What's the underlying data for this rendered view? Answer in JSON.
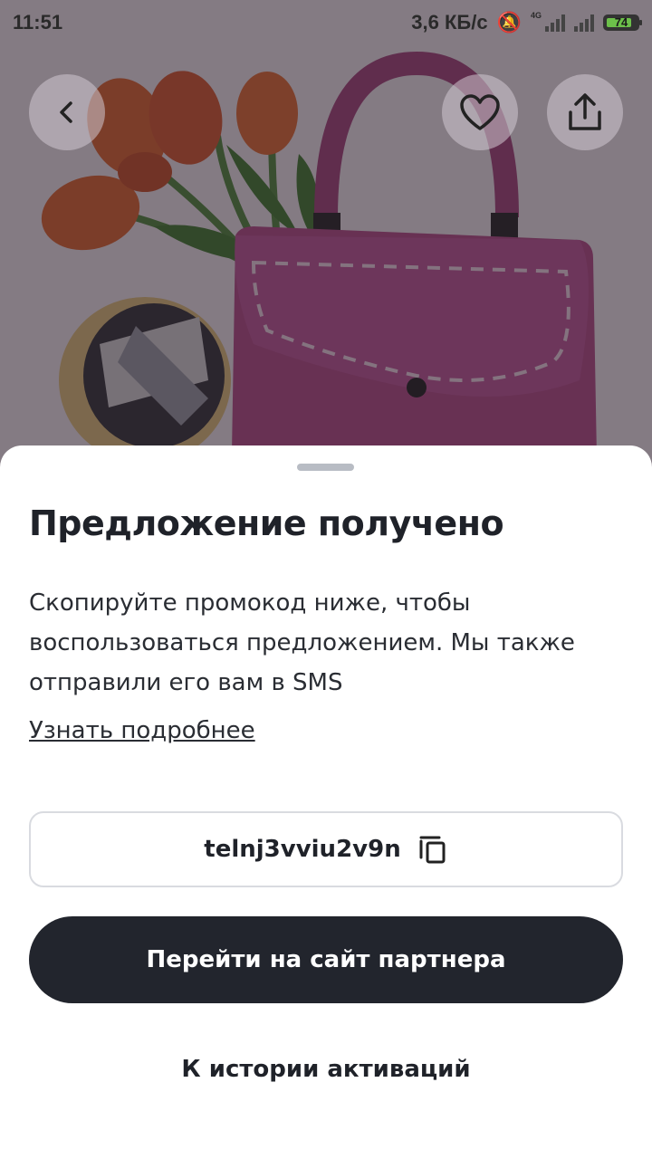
{
  "status_bar": {
    "time": "11:51",
    "speed": "3,6 КБ/с",
    "network_tag": "4G",
    "battery": "74",
    "icons": [
      "mute-icon",
      "signal-icon",
      "battery-icon"
    ]
  },
  "nav": {
    "back_icon": "chevron-left-icon",
    "favorite_icon": "heart-icon",
    "share_icon": "share-icon"
  },
  "sheet": {
    "title": "Предложение получено",
    "description": "Скопируйте промокод ниже, чтобы воспользоваться предложением. Мы также отправили его вам в SMS",
    "more_link": "Узнать подробнее",
    "promo_code": "telnj3vviu2v9n",
    "copy_icon": "copy-icon",
    "partner_button": "Перейти на сайт партнера",
    "history_link": "К истории активаций"
  },
  "colors": {
    "button_dark": "#22252d",
    "text_primary": "#1f2229",
    "sheet_background": "#ffffff",
    "battery_green": "#6cc04a"
  }
}
